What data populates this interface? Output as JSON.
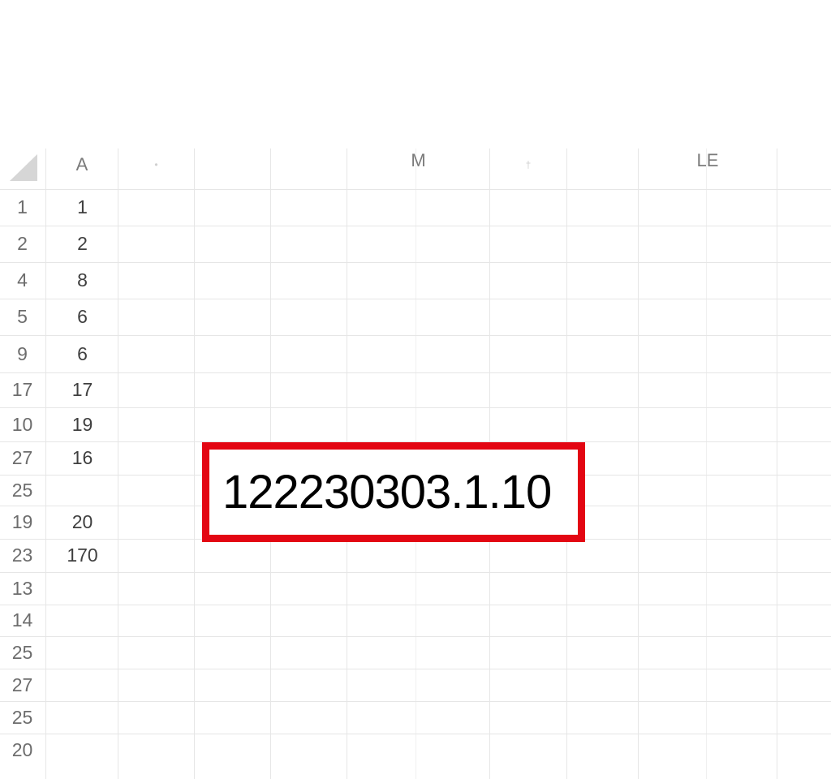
{
  "column_headers": [
    "A",
    "•",
    "",
    "",
    "M",
    "†",
    "",
    "LE"
  ],
  "rows": [
    {
      "row": "1",
      "a": "1"
    },
    {
      "row": "2",
      "a": "2"
    },
    {
      "row": "4",
      "a": "8"
    },
    {
      "row": "5",
      "a": "6"
    },
    {
      "row": "9",
      "a": "6"
    },
    {
      "row": "17",
      "a": "17"
    },
    {
      "row": "10",
      "a": "19"
    },
    {
      "row": "27",
      "a": "16"
    },
    {
      "row": "25",
      "a": ""
    },
    {
      "row": "19",
      "a": "20"
    },
    {
      "row": "23",
      "a": "170"
    },
    {
      "row": "13",
      "a": ""
    },
    {
      "row": "14",
      "a": ""
    },
    {
      "row": "25",
      "a": ""
    },
    {
      "row": "27",
      "a": ""
    },
    {
      "row": "25",
      "a": ""
    },
    {
      "row": "20",
      "a": ""
    }
  ],
  "highlight": {
    "value": "122230303.1.10",
    "border_color": "#e30613"
  },
  "colors": {
    "grid_line": "#e6e6e6",
    "header_text": "#7b7b7b"
  }
}
